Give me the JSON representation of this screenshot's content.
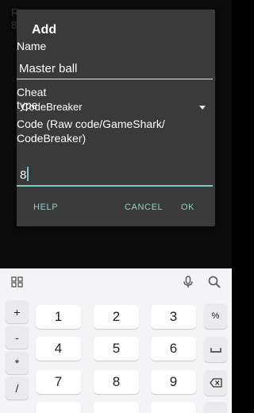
{
  "background": {
    "line1": "Ro",
    "line2": "8"
  },
  "dialog": {
    "title": "Add",
    "name_label": "Name",
    "name_value": "Master ball",
    "cheat_type_label": "Cheat type",
    "cheat_type_value": "CodeBreaker",
    "code_label": "Code (Raw code/GameShark/ CodeBreaker)",
    "code_value": "8",
    "buttons": {
      "help": "HELP",
      "cancel": "CANCEL",
      "ok": "OK"
    }
  },
  "keyboard": {
    "icons": [
      "grid-icon",
      "mic-icon",
      "search-icon"
    ],
    "left_keys": [
      "+",
      "-",
      "*",
      "/"
    ],
    "digits": [
      "1",
      "2",
      "3",
      "4",
      "5",
      "6",
      "7",
      "8",
      "9"
    ],
    "right_keys": [
      "%",
      "space",
      "backspace"
    ],
    "colors": {
      "accent": "#7fcbc3",
      "dialog_bg": "#3a3a3a",
      "keyboard_bg": "#f4f4f6"
    }
  }
}
